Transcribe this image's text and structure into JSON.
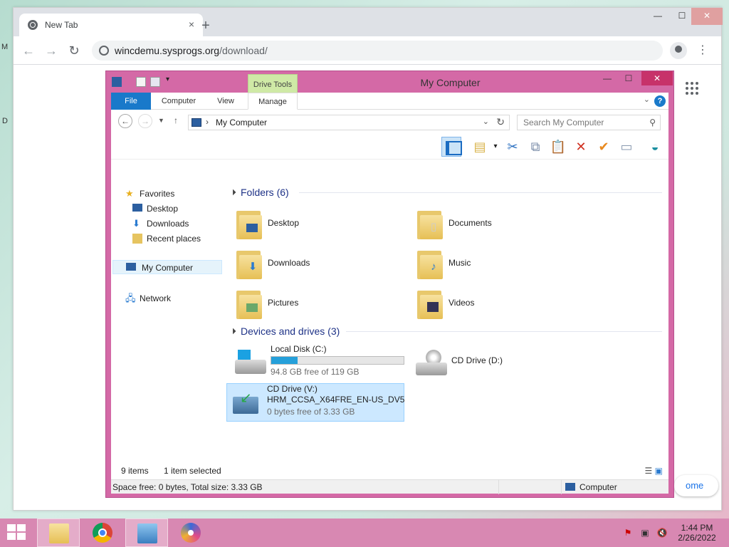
{
  "browser": {
    "tab_title": "New Tab",
    "tab_close": "×",
    "new_tab": "+",
    "url_host": "wincdemu.sysprogs.org",
    "url_path": "/download/",
    "win_min": "—",
    "win_max": "☐",
    "win_close": "✕",
    "customize_label": "ome"
  },
  "desktop": {
    "edge_label_1": "M",
    "edge_label_2": "D"
  },
  "explorer": {
    "title": "My Computer",
    "drive_tools": "Drive Tools",
    "tabs": {
      "file": "File",
      "computer": "Computer",
      "view": "View",
      "manage": "Manage"
    },
    "help": "?",
    "address": "My Computer",
    "search_placeholder": "Search My Computer",
    "nav": {
      "favorites": "Favorites",
      "desktop": "Desktop",
      "downloads": "Downloads",
      "recent": "Recent places",
      "my_computer": "My Computer",
      "network": "Network"
    },
    "folders_header": "Folders (6)",
    "folders": [
      "Desktop",
      "Documents",
      "Downloads",
      "Music",
      "Pictures",
      "Videos"
    ],
    "devices_header": "Devices and drives (3)",
    "drives": {
      "c_name": "Local Disk (C:)",
      "c_free": "94.8 GB free of 119 GB",
      "c_used_fraction": 0.2,
      "d_name": "CD Drive (D:)",
      "v_name": "CD Drive (V:)",
      "v_label": "HRM_CCSA_X64FRE_EN-US_DV5",
      "v_free": "0 bytes free of 3.33 GB"
    },
    "status": {
      "items": "9 items",
      "selected": "1 item selected",
      "space": "Space free: 0 bytes, Total size: 3.33 GB",
      "location": "Computer"
    }
  },
  "taskbar": {
    "time": "1:44 PM",
    "date": "2/26/2022"
  },
  "colors": {
    "window_frame": "#d469a6",
    "accent": "#1979ca",
    "taskbar": "#d888b2"
  }
}
